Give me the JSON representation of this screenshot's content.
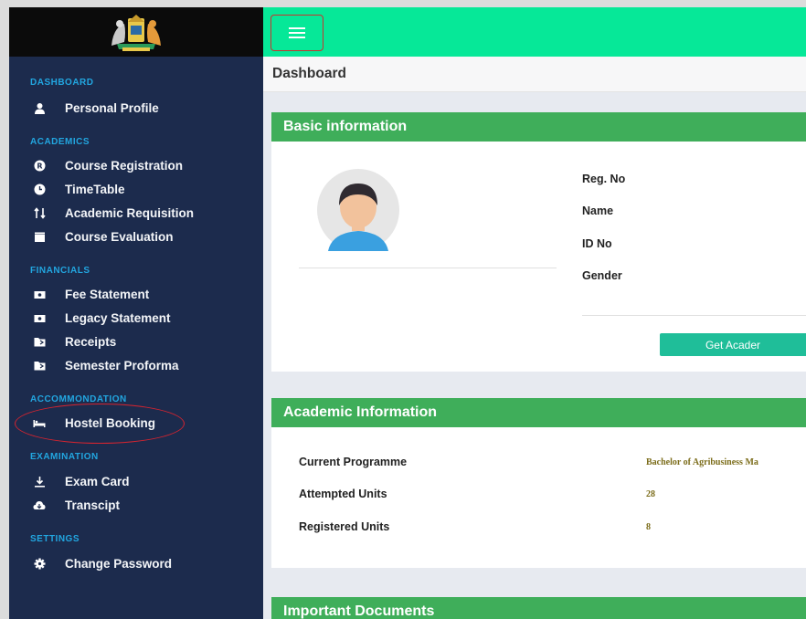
{
  "topbar": {
    "menu_icon": "hamburger-menu-icon"
  },
  "breadcrumb": {
    "title": "Dashboard"
  },
  "sidebar": {
    "sections": [
      {
        "title": "DASHBOARD",
        "items": [
          {
            "label": "Personal Profile",
            "icon": "user-icon"
          }
        ]
      },
      {
        "title": "ACADEMICS",
        "items": [
          {
            "label": "Course Registration",
            "icon": "registered-icon"
          },
          {
            "label": "TimeTable",
            "icon": "clock-icon"
          },
          {
            "label": "Academic Requisition",
            "icon": "transfer-icon"
          },
          {
            "label": "Course Evaluation",
            "icon": "clapperboard-icon"
          }
        ]
      },
      {
        "title": "FINANCIALS",
        "items": [
          {
            "label": "Fee Statement",
            "icon": "money-bill-icon"
          },
          {
            "label": "Legacy Statement",
            "icon": "money-bill-icon"
          },
          {
            "label": "Receipts",
            "icon": "folder-share-icon"
          },
          {
            "label": "Semester Proforma",
            "icon": "folder-share-icon"
          }
        ]
      },
      {
        "title": "ACCOMMONDATION",
        "items": [
          {
            "label": "Hostel Booking",
            "icon": "bed-icon"
          }
        ]
      },
      {
        "title": "EXAMINATION",
        "items": [
          {
            "label": "Exam Card",
            "icon": "download-icon"
          },
          {
            "label": "Transcipt",
            "icon": "cloud-download-icon"
          }
        ]
      },
      {
        "title": "SETTINGS",
        "items": [
          {
            "label": "Change Password",
            "icon": "gear-icon"
          }
        ]
      }
    ]
  },
  "basic_info": {
    "header": "Basic information",
    "labels": [
      "Reg. No",
      "Name",
      "ID No",
      "Gender"
    ],
    "button_label": "Get Acader"
  },
  "academic_info": {
    "header": "Academic Information",
    "rows": [
      {
        "label": "Current Programme",
        "value": "Bachelor of Agribusiness Ma"
      },
      {
        "label": "Attempted Units",
        "value": "28"
      },
      {
        "label": "Registered Units",
        "value": "8"
      }
    ]
  },
  "documents": {
    "header": "Important Documents"
  },
  "colors": {
    "sidebar_bg": "#1c2b4d",
    "topbar_bg": "#06e898",
    "card_header": "#3fae5a",
    "section_title": "#22a6e0",
    "button": "#1fbe99",
    "annotation_red": "#d8242f"
  }
}
